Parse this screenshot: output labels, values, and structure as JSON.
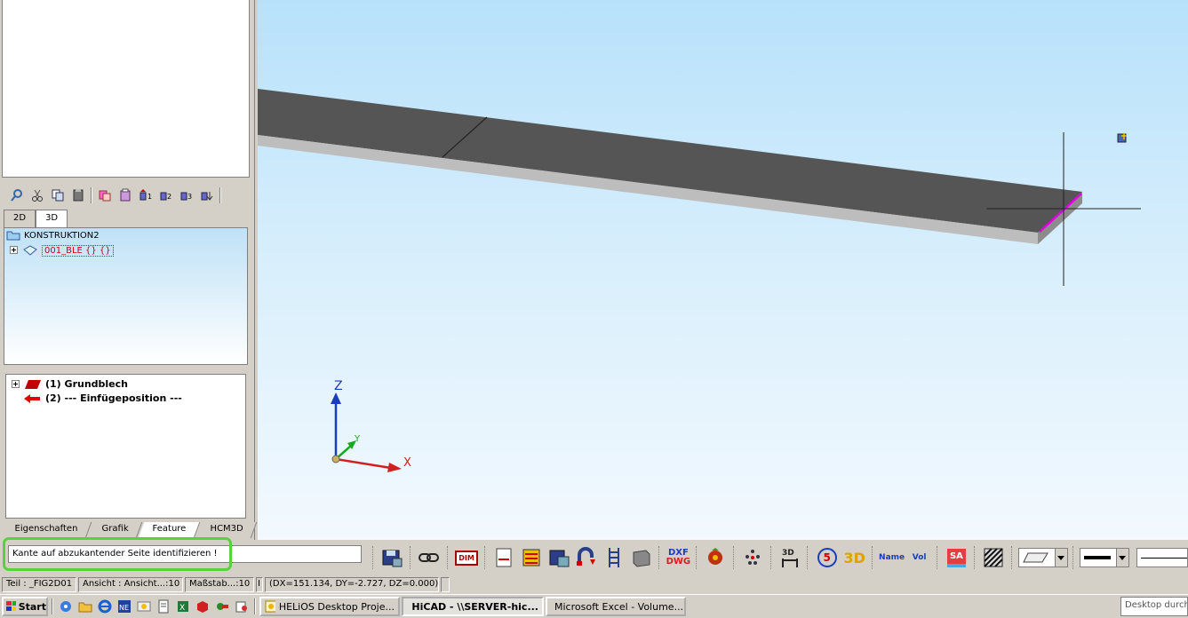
{
  "tree": {
    "tabs": [
      "2D",
      "3D"
    ],
    "root": "KONSTRUKTION2",
    "part": "001_BLE {} {}"
  },
  "features": {
    "items": [
      {
        "label": "(1) Grundblech",
        "color": "#c00000"
      },
      {
        "label": "(2) --- Einfügeposition ---",
        "color": "#e00000"
      }
    ],
    "tabs": [
      "Eigenschaften",
      "Grafik",
      "Feature",
      "HCM3D"
    ]
  },
  "axes": {
    "x": "X",
    "y": "Y",
    "z": "Z"
  },
  "command": {
    "prompt": "Kante auf abzukantender Seite identifizieren !"
  },
  "toolbar": {
    "dim": "DIM",
    "dxf": "DXF",
    "dwg": "DWG",
    "five": "5",
    "three_d": "3D",
    "name": "Name",
    "vol": "Vol",
    "sa": "SA"
  },
  "status": {
    "teil": "Teil : _FIG2D01",
    "ansicht": "Ansicht : Ansicht...:10",
    "massstab": "Maßstab...:10",
    "sep": "I",
    "delta": "(DX=151.134, DY=-2.727, DZ=0.000)"
  },
  "taskbar": {
    "start": "Start",
    "tasks": [
      "HELiOS Desktop     Proje...",
      "HiCAD - \\\\SERVER-hic...",
      "Microsoft Excel - Volume..."
    ],
    "desktop": "Desktop durchsuchen"
  },
  "colors": {
    "highlight": "#58d23c",
    "sheet_top": "#555555",
    "sheet_edge": "#bdbdbd",
    "selected_edge": "#e000e0"
  }
}
